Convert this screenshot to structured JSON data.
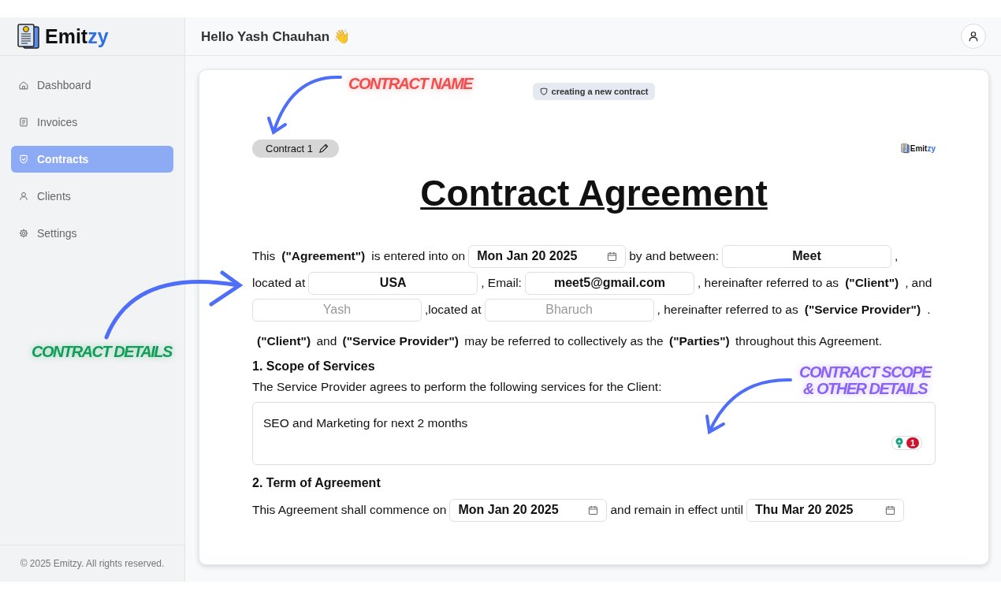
{
  "sidebar": {
    "logo": {
      "prefix": "Emit",
      "suffix": "zy"
    },
    "items": [
      {
        "label": "Dashboard",
        "selected": false
      },
      {
        "label": "Invoices",
        "selected": false
      },
      {
        "label": "Contracts",
        "selected": true
      },
      {
        "label": "Clients",
        "selected": false
      },
      {
        "label": "Settings",
        "selected": false
      }
    ],
    "footer": "© 2025 Emitzy. All rights reserved."
  },
  "header": {
    "greeting": "Hello Yash Chauhan 👋"
  },
  "contract": {
    "status_badge": "creating a new contract",
    "name": "Contract 1",
    "brand": {
      "prefix": "Emit",
      "suffix": "zy"
    },
    "title": "Contract Agreement",
    "intro": [
      {
        "kind": "text",
        "text": "This"
      },
      {
        "kind": "bold",
        "text": "(\"Agreement\")"
      },
      {
        "kind": "text",
        "text": "is entered into on"
      },
      {
        "kind": "date",
        "value": "Mon Jan 20 2025"
      },
      {
        "kind": "text",
        "text": "by and between:"
      },
      {
        "kind": "field",
        "value": "Meet"
      },
      {
        "kind": "text",
        "text": ","
      },
      {
        "kind": "text",
        "text": "located at"
      },
      {
        "kind": "field",
        "value": "USA"
      },
      {
        "kind": "text",
        "text": ", Email:"
      },
      {
        "kind": "field",
        "value": "meet5@gmail.com"
      },
      {
        "kind": "text",
        "text": ", hereinafter referred to as"
      },
      {
        "kind": "bold",
        "text": "(\"Client\")"
      },
      {
        "kind": "text",
        "text": ","
      },
      {
        "kind": "text",
        "text": "and"
      },
      {
        "kind": "field",
        "placeholder": "Yash"
      },
      {
        "kind": "text",
        "text": ",located at"
      },
      {
        "kind": "field",
        "placeholder": "Bharuch"
      },
      {
        "kind": "text",
        "text": ", hereinafter referred to as"
      },
      {
        "kind": "bold",
        "text": "(\"Service Provider\")"
      },
      {
        "kind": "text",
        "text": "."
      }
    ],
    "parties": "**(\"Client\")** and **(\"Service Provider\")** may be referred to collectively as the **(\"Parties\")** throughout this Agreement.",
    "scope": {
      "heading": "1. Scope of Services",
      "text": "The Service Provider agrees to perform the following services for the Client:",
      "value": "SEO and Marketing for next 2 months",
      "issue_count": "1"
    },
    "term": {
      "heading": "2. Term of Agreement",
      "segments": [
        {
          "kind": "text",
          "text": "This Agreement shall commence on"
        },
        {
          "kind": "date",
          "value": "Mon Jan 20 2025"
        },
        {
          "kind": "text",
          "text": "and remain in effect until"
        },
        {
          "kind": "date",
          "value": "Thu Mar 20 2025"
        }
      ]
    }
  },
  "annotations": [
    {
      "text": "CONTRACT NAME",
      "color": "#f24c4c"
    },
    {
      "text": "CONTRACT DETAILS",
      "color": "#0f9d58"
    },
    {
      "text": "CONTRACT SCOPE & OTHER DETAILS",
      "color": "#8a63f5"
    }
  ]
}
